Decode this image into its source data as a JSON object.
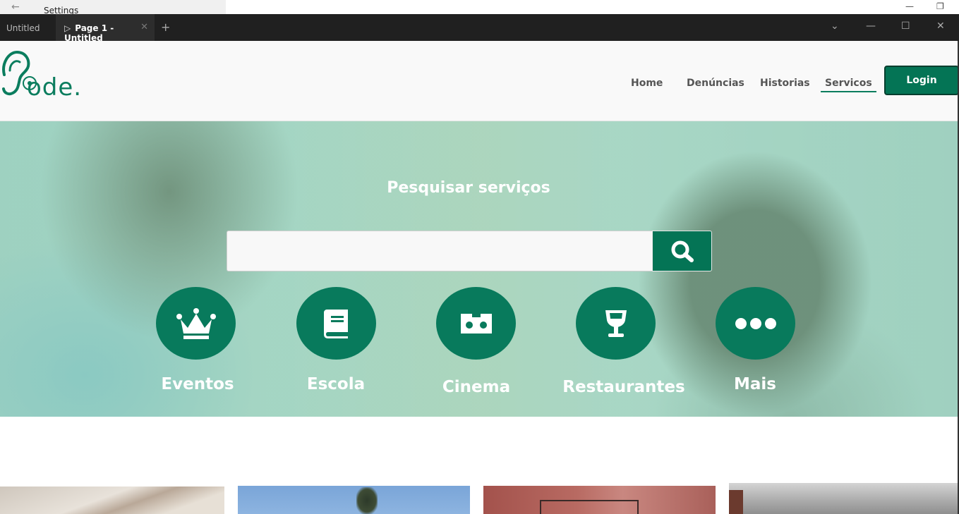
{
  "background_window": {
    "title": "Settings"
  },
  "titlebar": {
    "tabs": [
      {
        "label": "Untitled",
        "active": false
      },
      {
        "label": "Page 1 - Untitled",
        "active": true
      }
    ]
  },
  "navbar": {
    "logo_text": "ode.",
    "links": [
      {
        "label": "Home",
        "active": false
      },
      {
        "label": "Denúncias",
        "active": false
      },
      {
        "label": "Historias",
        "active": false
      },
      {
        "label": "Servicos",
        "active": true
      }
    ],
    "login_label": "Login"
  },
  "hero": {
    "title": "Pesquisar serviços",
    "search_placeholder": "",
    "categories": [
      {
        "label": "Eventos",
        "icon": "crown-icon"
      },
      {
        "label": "Escola",
        "icon": "book-icon"
      },
      {
        "label": "Cinema",
        "icon": "cinema-ticket-icon"
      },
      {
        "label": "Restaurantes",
        "icon": "wine-glass-icon"
      },
      {
        "label": "Mais",
        "icon": "more-dots-icon"
      }
    ]
  },
  "colors": {
    "brand_green": "#047455",
    "hero_overlay": "#7bcbaf",
    "nav_text": "#555555"
  }
}
